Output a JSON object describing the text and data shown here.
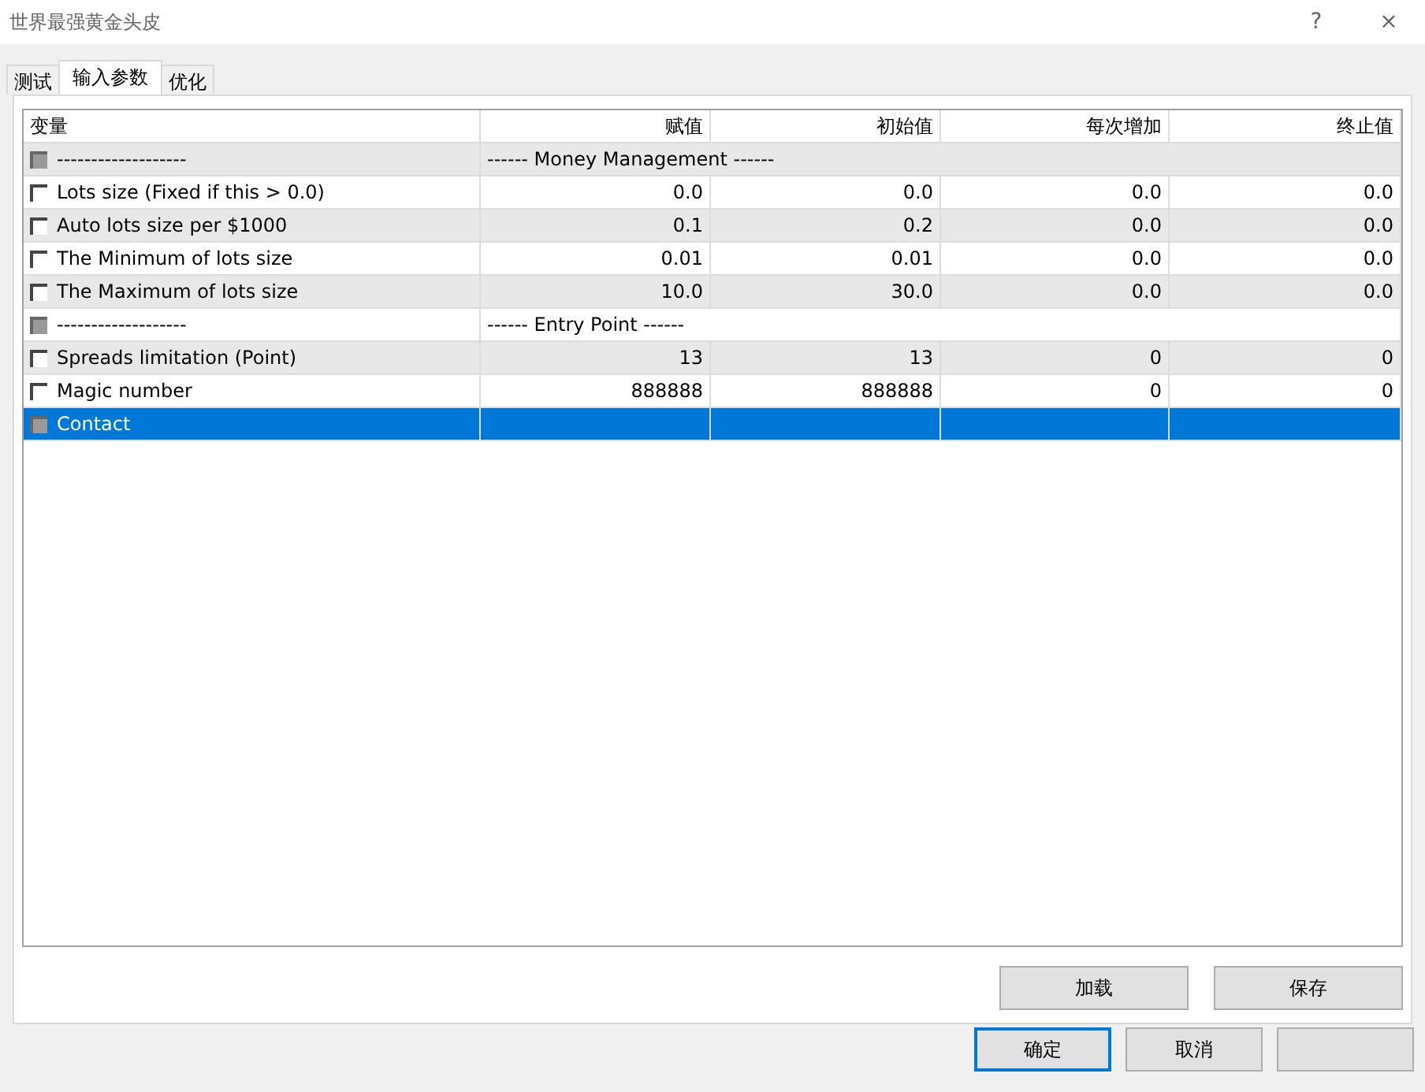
{
  "window": {
    "title": "世界最强黄金头皮",
    "help": "?",
    "close": "×"
  },
  "tabs": [
    {
      "label": "测试",
      "selected": false
    },
    {
      "label": "输入参数",
      "selected": true
    },
    {
      "label": "优化",
      "selected": false
    }
  ],
  "table": {
    "columns": [
      "变量",
      "赋值",
      "初始值",
      "每次增加",
      "终止值"
    ],
    "rows": [
      {
        "kind": "separator",
        "name": "-------------------",
        "value": "------ Money Management ------",
        "checked": false,
        "disabled": true,
        "selected": false
      },
      {
        "kind": "param",
        "name": "Lots size (Fixed if this > 0.0)",
        "value": "0.0",
        "start": "0.0",
        "step": "0.0",
        "stop": "0.0",
        "checked": false,
        "disabled": false,
        "selected": false
      },
      {
        "kind": "param",
        "name": "Auto lots size per $1000",
        "value": "0.1",
        "start": "0.2",
        "step": "0.0",
        "stop": "0.0",
        "checked": false,
        "disabled": false,
        "selected": false
      },
      {
        "kind": "param",
        "name": "The Minimum of lots size",
        "value": "0.01",
        "start": "0.01",
        "step": "0.0",
        "stop": "0.0",
        "checked": false,
        "disabled": false,
        "selected": false
      },
      {
        "kind": "param",
        "name": "The Maximum of lots size",
        "value": "10.0",
        "start": "30.0",
        "step": "0.0",
        "stop": "0.0",
        "checked": false,
        "disabled": false,
        "selected": false
      },
      {
        "kind": "separator",
        "name": "-------------------",
        "value": "------ Entry Point ------",
        "checked": false,
        "disabled": true,
        "selected": false
      },
      {
        "kind": "param",
        "name": "Spreads limitation (Point)",
        "value": "13",
        "start": "13",
        "step": "0",
        "stop": "0",
        "checked": false,
        "disabled": false,
        "selected": false
      },
      {
        "kind": "param",
        "name": "Magic number",
        "value": "888888",
        "start": "888888",
        "step": "0",
        "stop": "0",
        "checked": false,
        "disabled": false,
        "selected": false
      },
      {
        "kind": "separator",
        "name": "Contact",
        "checked": false,
        "disabled": true,
        "selected": true
      }
    ]
  },
  "buttons_top": [
    "加载",
    "保存"
  ],
  "buttons_bottom": [
    {
      "label": "确定",
      "default": true
    },
    {
      "label": "取消",
      "default": false
    },
    {
      "default": false
    }
  ]
}
